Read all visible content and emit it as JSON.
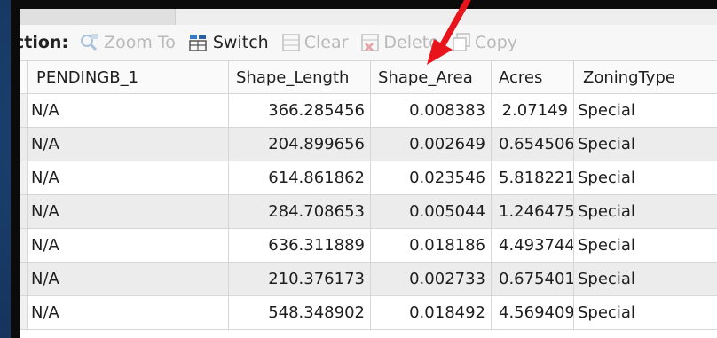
{
  "toolbar": {
    "selection_label": "ction:",
    "buttons": [
      {
        "label": "Zoom To",
        "icon": "zoom-to-icon",
        "enabled": false
      },
      {
        "label": "Switch",
        "icon": "switch-icon",
        "enabled": true
      },
      {
        "label": "Clear",
        "icon": "clear-icon",
        "enabled": false
      },
      {
        "label": "Delete",
        "icon": "delete-icon",
        "enabled": false
      },
      {
        "label": "Copy",
        "icon": "copy-icon",
        "enabled": false
      }
    ]
  },
  "table": {
    "columns": [
      "PENDINGB_1",
      "Shape_Length",
      "Shape_Area",
      "Acres",
      "ZoningType"
    ],
    "rows": [
      [
        "N/A",
        "366.285456",
        "0.008383",
        "2.07149",
        "Special"
      ],
      [
        "N/A",
        "204.899656",
        "0.002649",
        "0.654506",
        "Special"
      ],
      [
        "N/A",
        "614.861862",
        "0.023546",
        "5.818221",
        "Special"
      ],
      [
        "N/A",
        "284.708653",
        "0.005044",
        "1.246475",
        "Special"
      ],
      [
        "N/A",
        "636.311889",
        "0.018186",
        "4.493744",
        "Special"
      ],
      [
        "N/A",
        "210.376173",
        "0.002733",
        "0.675401",
        "Special"
      ],
      [
        "N/A",
        "548.348902",
        "0.018492",
        "4.569409",
        "Special"
      ]
    ],
    "selected_cell": {
      "row": 1,
      "column": 0
    }
  },
  "annotation": {
    "arrow_color": "#e8141b",
    "points_to": "Shape_Area"
  },
  "colors": {
    "background": "#1d4272",
    "selected_cell": "#cde0f0",
    "alt_row": "#ececec"
  }
}
